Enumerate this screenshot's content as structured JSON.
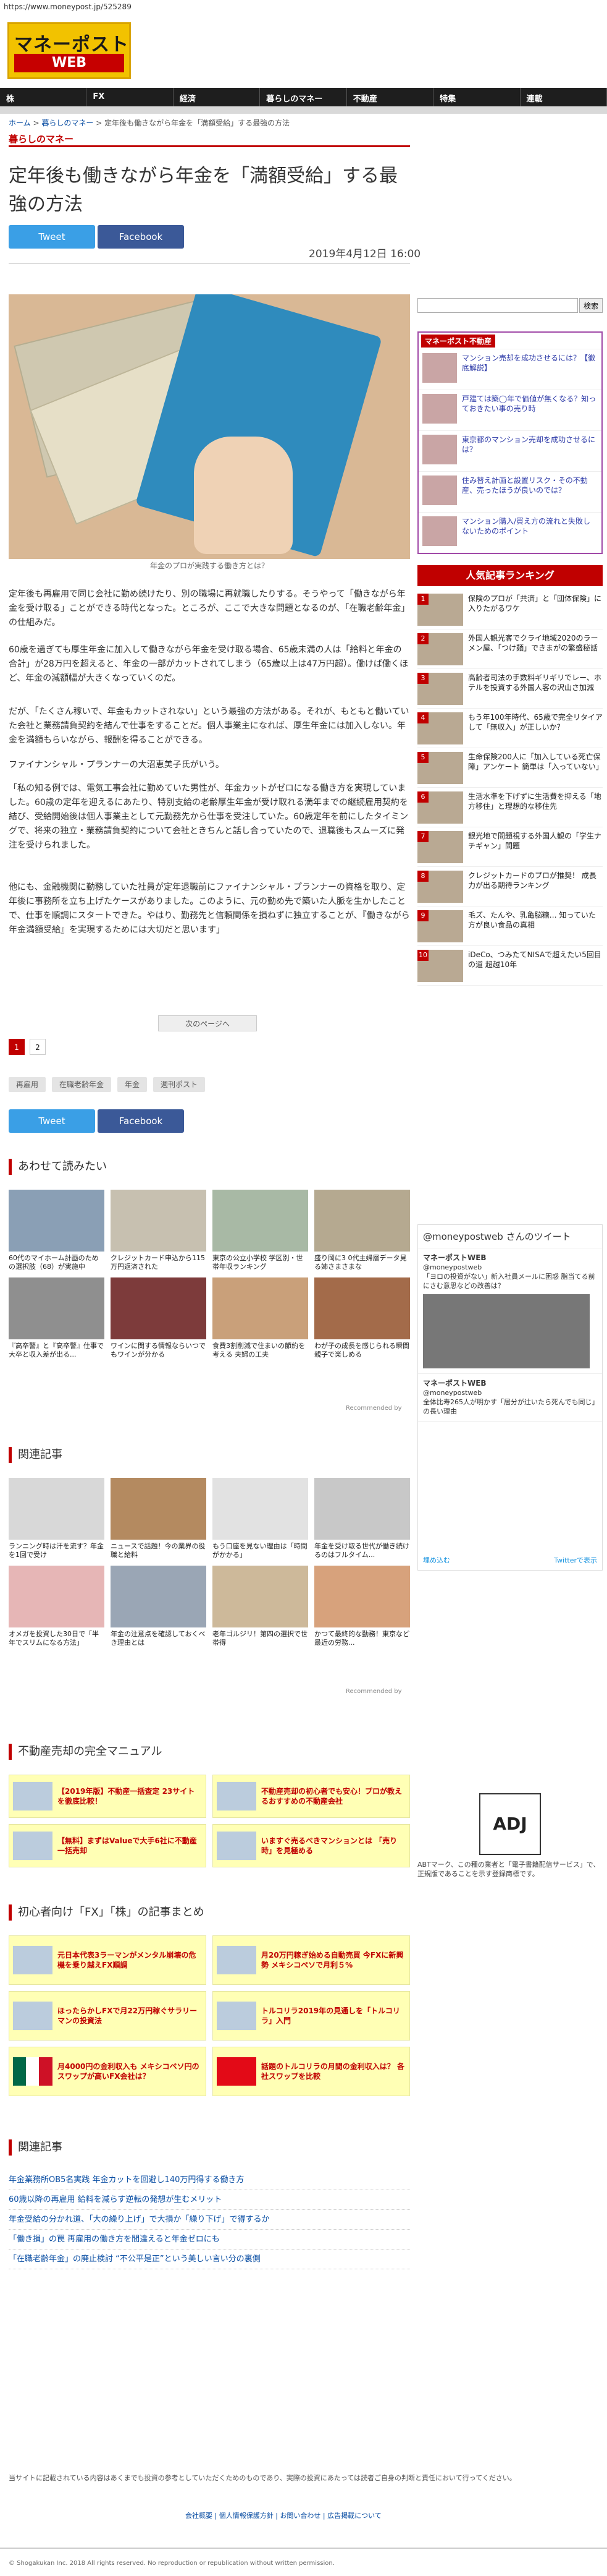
{
  "url": "https://www.moneypost.jp/525289",
  "logo": {
    "line1": "マネーポスト",
    "line2": "WEB"
  },
  "nav": [
    "株",
    "FX",
    "経済",
    "暮らしのマネー",
    "不動産",
    "特集",
    "連載"
  ],
  "breadcrumb": {
    "home": "ホーム",
    "section": "暮らしのマネー",
    "current": "定年後も働きながら年金を「満額受給」する最強の方法"
  },
  "section": "暮らしのマネー",
  "article": {
    "title": "定年後も働きながら年金を「満額受給」する最強の方法",
    "date": "2019年4月12日 16:00",
    "caption": "年金のプロが実践する働き方とは？",
    "paragraphs": [
      "定年後も再雇用で同じ会社に勤め続けたり、別の職場に再就職したりする。そうやって「働きながら年金を受け取る」ことができる時代となった。ところが、ここで大きな問題となるのが、「在職老齢年金」の仕組みだ。",
      "60歳を過ぎても厚生年金に加入して働きながら年金を受け取る場合、65歳未満の人は「給料と年金の合計」が28万円を超えると、年金の一部がカットされてしまう（65歳以上は47万円超）。働けば働くほど、年金の減額幅が大きくなっていくのだ。",
      "だが、「たくさん稼いで、年金もカットされない」という最強の方法がある。それが、もともと働いていた会社と業務請負契約を結んで仕事をすることだ。個人事業主になれば、厚生年金には加入しない。年金を満額もらいながら、報酬を得ることができる。",
      "ファイナンシャル・プランナーの大沼恵美子氏がいう。",
      "「私の知る例では、電気工事会社に勤めていた男性が、年金カットがゼロになる働き方を実現していました。60歳の定年を迎えるにあたり、特別支給の老齢厚生年金が受け取れる満年までの継続雇用契約を結び、受給開始後は個人事業主として元勤務先から仕事を受注していた。60歳定年を前にしたタイミングで、将来の独立・業務請負契約について会社ときちんと話し合っていたので、退職後もスムーズに発注を受けられました。",
      "他にも、金融機関に勤務していた社員が定年退職前にファイナンシャル・プランナーの資格を取り、定年後に事務所を立ち上げたケースがありました。このように、元の勤め先で築いた人脈を生かしたことで、仕事を順調にスタートできた。やはり、勤務先と信頼関係を損ねずに独立することが、『働きながら年金満額受給』を実現するためには大切だと思います」"
    ],
    "next_label": "次のページへ"
  },
  "share": {
    "tweet": "Tweet",
    "facebook": "Facebook"
  },
  "pages": [
    "1",
    "2"
  ],
  "tags": [
    "再雇用",
    "在職老齢年金",
    "年金",
    "週刊ポスト"
  ],
  "sections": {
    "related_read": "あわせて読みたい",
    "related_articles": "関連記事",
    "realestate_manual": "不動産売却の完全マニュアル",
    "fx_stock": "初心者向け「FX」「株」の記事まとめ",
    "related2": "関連記事"
  },
  "grid1": [
    {
      "t": "60代のマイホーム計画のための選択肢（68）が実施中",
      "s": ""
    },
    {
      "t": "クレジットカード申込から115万円返済された",
      "s": ""
    },
    {
      "t": "東京の公立小学校 学区別・世帯年収ランキング",
      "s": ""
    },
    {
      "t": "盛り岡に3 0代主婦層データ見る姉さまさまな",
      "s": ""
    },
    {
      "t": "『高卒警』と『高卒警』仕事で大卒と収入差が出る...",
      "s": ""
    },
    {
      "t": "ワインに関する情報ならいつでもワインが分かる",
      "s": ""
    },
    {
      "t": "食費3割削減で住まいの節約を考える 夫婦の工夫",
      "s": ""
    },
    {
      "t": "わが子の成長を感じられる瞬間 親子で楽しめる",
      "s": ""
    }
  ],
  "grid2": [
    {
      "t": "ランニング時は汗を流す？年金を1回で受け",
      "s": ""
    },
    {
      "t": "ニュースで話題！今の業界の役職と給料",
      "s": ""
    },
    {
      "t": "もう口座を見ない理由は「時間がかかる」",
      "s": ""
    },
    {
      "t": "年金を受け取る世代が働き続けるのはフルタイム...",
      "s": ""
    },
    {
      "t": "オメガを投資した30日で「半年でスリムになる方法」",
      "s": ""
    },
    {
      "t": "年金の注意点を確認しておくべき理由とは",
      "s": ""
    },
    {
      "t": "老年ゴルジリ！第四の選択で世帯得",
      "s": ""
    },
    {
      "t": "かつて最終的な勤務！東京など最近の労務...",
      "s": ""
    }
  ],
  "recommended_by": "Recommended by",
  "manual_links": [
    "【2019年版】不動産一括査定 23サイトを徹底比較！",
    "不動産売却の初心者でも安心！プロが教えるおすすめの不動産会社",
    "【無料】まずはValueで大手6社に不動産一括売却",
    "いますぐ売るべきマンションとは 「売り時」を見極める"
  ],
  "fx_links": [
    "元日本代表3ラーマンがメンタル崩壊の危機を乗り越えFX順調",
    "月20万円稼ぎ始める自動売買 今FXに新興勢 メキシコペソで月利５%",
    "ほったらかしFXで月22万円稼ぐサラリーマンの投資法",
    "トルコリラ2019年の見通しを「トルコリラ」入門",
    "月4000円の金利収入も メキシコペソ円のスワップが高いFX会社は？",
    "話題のトルコリラの月間の金利収入は？ 各社スワップを比較"
  ],
  "related_links": [
    "年金業務所OB5名実践 年金カットを回避し140万円得する働き方",
    "60歳以降の再雇用 給料を減らす逆転の発想が生むメリット",
    "年金受給の分かれ道、「大の繰り上げ」で大損か「繰り下げ」で得するか",
    "「働き損」の罠 再雇用の働き方を間違えると年金ゼロにも",
    "「在職老齢年金」の廃止検討 “不公平是正”という美しい言い分の裏側"
  ],
  "sidebar": {
    "search_placeholder": "",
    "search_button": "検索",
    "realestate_badge": "マネーポスト不動産",
    "realestate_items": [
      "マンション売却を成功させるには？【徹底解説】",
      "戸建ては築◯年で価値が無くなる？知っておきたい事の売り時",
      "東京都のマンション売却を成功させるには？",
      "住み替え計画と設置リスク・その不動産、売ったほうが良いのでは？",
      "マンション購入/買え方の流れと失敗しないためのポイント"
    ],
    "ranking_title": "人気記事ランキング",
    "ranking": [
      "保険のプロが「共済」と「団体保険」に入りたがるワケ",
      "外国人観光客でクライ地域2020のラーメン屋、「つけ麺」できまがの繁盛秘話",
      "高齢者司法の手数料ギリギリでレー、ホテルを投資する外国人客の沢山さ加減",
      "もう年100年時代、65歳で完全リタイアして「無収入」が正しいか？",
      "生命保険200人に「加入している死亡保障」アンケート 簡単は「入っていない」",
      "生活水準を下げずに生活費を抑える「地方移住」と理想的な移住先",
      "銀光地で問題視する外国人観の「学生ナチギャン」問題",
      "クレジットカードのプロが推奨！ 成長力が出る期待ランキング",
      "毛ズ、たんや、乳亀脳糖… 知っていた方が良い食品の真相",
      "iDeCo、つみたてNISAで超えたい5回目の道 超越10年"
    ],
    "twitter": {
      "title": "@moneypostweb さんのツイート",
      "tweets": [
        {
          "name": "マネーポストWEB",
          "handle": "@moneypostweb",
          "text": "「ヨロの投資がない」新入社員メールに困惑 脂当てる前にさむ意思などの改善は？"
        },
        {
          "name": "マネーポストWEB",
          "handle": "@moneypostweb",
          "text": "全体比寿265人が明かす「居分が辻いたら死んでも同じ」の長い理由"
        }
      ],
      "embed": "埋め込む",
      "view": "Twitterで表示"
    },
    "adj_text": "ADJ",
    "adj_desc": "ABTマーク、この種の業者と「電子書籍配信サービス」で、正規版であることを示す登録商標です。"
  },
  "footer": {
    "note": "当サイトに記載されている内容はあくまでも投資の参考としていただくためのものであり、実際の投資にあたっては読者ご自身の判断と責任において行ってください。",
    "links": [
      "会社概要",
      "個人情報保護方針",
      "お問い合わせ",
      "広告掲載について"
    ],
    "copy": "© Shogakukan Inc. 2018 All rights reserved. No reproduction or republication without written permission."
  }
}
